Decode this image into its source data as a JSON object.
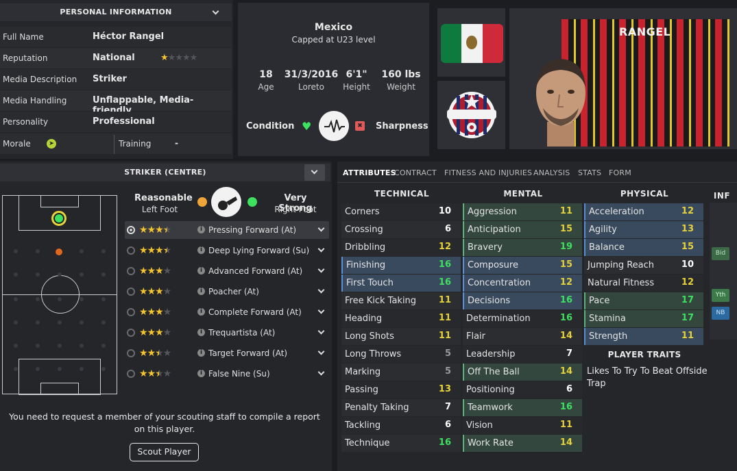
{
  "personal": {
    "header": "PERSONAL INFORMATION",
    "rows": [
      {
        "label": "Full Name",
        "value": "Héctor Rangel"
      },
      {
        "label": "Reputation",
        "value": "National"
      },
      {
        "label": "Media Description",
        "value": "Striker"
      },
      {
        "label": "Media Handling",
        "value": "Unflappable, Media-friendly"
      },
      {
        "label": "Personality",
        "value": "Professional"
      }
    ],
    "reputation_stars": 1,
    "morale_label": "Morale",
    "training_label": "Training",
    "training_value": "-"
  },
  "nation": {
    "country": "Mexico",
    "caps": "Capped at U23 level",
    "stats": [
      {
        "value": "18",
        "label": "Age"
      },
      {
        "value": "31/3/2016",
        "label": "Loreto"
      },
      {
        "value": "6'1\"",
        "label": "Height"
      },
      {
        "value": "160 lbs",
        "label": "Weight"
      }
    ],
    "condition_label": "Condition",
    "sharpness_label": "Sharpness"
  },
  "player_card": {
    "shirt_name": "RANGEL"
  },
  "position": {
    "header": "STRIKER (CENTRE)",
    "left_foot_level": "Reasonable",
    "left_foot_label": "Left Foot",
    "right_foot_level": "Very Strong",
    "right_foot_label": "Right Foot",
    "roles": [
      {
        "name": "Pressing Forward (At)",
        "stars": 3.5
      },
      {
        "name": "Deep Lying Forward (Su)",
        "stars": 3.5
      },
      {
        "name": "Advanced Forward (At)",
        "stars": 3
      },
      {
        "name": "Poacher (At)",
        "stars": 3
      },
      {
        "name": "Complete Forward (At)",
        "stars": 3
      },
      {
        "name": "Trequartista (At)",
        "stars": 3
      },
      {
        "name": "Target Forward (At)",
        "stars": 2.5
      },
      {
        "name": "False Nine (Su)",
        "stars": 2.5
      }
    ],
    "scout_message": "You need to request a member of your scouting staff to compile a report on this player.",
    "scout_button": "Scout Player"
  },
  "tabs": [
    "ATTRIBUTES",
    "CONTRACT",
    "FITNESS AND INJURIES",
    "ANALYSIS",
    "STATS",
    "FORM"
  ],
  "attributes": {
    "technical_header": "TECHNICAL",
    "mental_header": "MENTAL",
    "physical_header": "PHYSICAL",
    "info_header": "INF",
    "technical": [
      {
        "name": "Corners",
        "value": "10",
        "hl": ""
      },
      {
        "name": "Crossing",
        "value": "6",
        "hl": ""
      },
      {
        "name": "Dribbling",
        "value": "12",
        "hl": ""
      },
      {
        "name": "Finishing",
        "value": "16",
        "hl": "blue"
      },
      {
        "name": "First Touch",
        "value": "16",
        "hl": "blue"
      },
      {
        "name": "Free Kick Taking",
        "value": "11",
        "hl": ""
      },
      {
        "name": "Heading",
        "value": "11",
        "hl": ""
      },
      {
        "name": "Long Shots",
        "value": "11",
        "hl": ""
      },
      {
        "name": "Long Throws",
        "value": "5",
        "hl": ""
      },
      {
        "name": "Marking",
        "value": "5",
        "hl": ""
      },
      {
        "name": "Passing",
        "value": "13",
        "hl": ""
      },
      {
        "name": "Penalty Taking",
        "value": "7",
        "hl": ""
      },
      {
        "name": "Tackling",
        "value": "6",
        "hl": ""
      },
      {
        "name": "Technique",
        "value": "16",
        "hl": ""
      }
    ],
    "mental": [
      {
        "name": "Aggression",
        "value": "11",
        "hl": "green"
      },
      {
        "name": "Anticipation",
        "value": "15",
        "hl": "green"
      },
      {
        "name": "Bravery",
        "value": "19",
        "hl": "green"
      },
      {
        "name": "Composure",
        "value": "15",
        "hl": "blue"
      },
      {
        "name": "Concentration",
        "value": "12",
        "hl": "blue"
      },
      {
        "name": "Decisions",
        "value": "16",
        "hl": "blue"
      },
      {
        "name": "Determination",
        "value": "16",
        "hl": ""
      },
      {
        "name": "Flair",
        "value": "14",
        "hl": ""
      },
      {
        "name": "Leadership",
        "value": "7",
        "hl": ""
      },
      {
        "name": "Off The Ball",
        "value": "14",
        "hl": "green"
      },
      {
        "name": "Positioning",
        "value": "6",
        "hl": ""
      },
      {
        "name": "Teamwork",
        "value": "16",
        "hl": "green"
      },
      {
        "name": "Vision",
        "value": "11",
        "hl": ""
      },
      {
        "name": "Work Rate",
        "value": "14",
        "hl": "green"
      }
    ],
    "physical": [
      {
        "name": "Acceleration",
        "value": "12",
        "hl": "blue"
      },
      {
        "name": "Agility",
        "value": "13",
        "hl": "blue"
      },
      {
        "name": "Balance",
        "value": "15",
        "hl": "blue"
      },
      {
        "name": "Jumping Reach",
        "value": "10",
        "hl": ""
      },
      {
        "name": "Natural Fitness",
        "value": "12",
        "hl": ""
      },
      {
        "name": "Pace",
        "value": "17",
        "hl": "green"
      },
      {
        "name": "Stamina",
        "value": "17",
        "hl": "green"
      },
      {
        "name": "Strength",
        "value": "11",
        "hl": "blue"
      }
    ],
    "traits_header": "PLAYER TRAITS",
    "traits": "Likes To Try To Beat Offside Trap",
    "side_badges": [
      "Bid",
      "Yth",
      "NB"
    ]
  },
  "colors": {
    "green": "#3ee060",
    "yellow": "#e6d23a",
    "blue_hl": "#3a4a5e",
    "green_hl": "#33473e"
  }
}
